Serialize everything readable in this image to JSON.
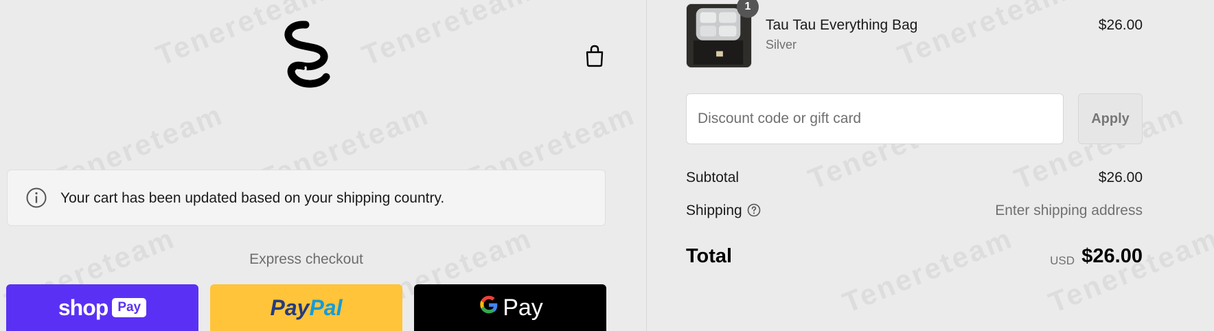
{
  "watermark": {
    "text": "Tenereteam"
  },
  "header": {
    "logo_icon": "tau-tau-logo-icon",
    "cart_icon": "shopping-bag-icon"
  },
  "notice": {
    "icon": "info-icon",
    "message": "Your cart has been updated based on your shipping country."
  },
  "express_checkout": {
    "heading": "Express checkout",
    "shop_pay": {
      "word": "shop",
      "badge": "Pay",
      "color": "#5a31f4"
    },
    "paypal": {
      "part1": "Pay",
      "part2": "Pal",
      "color": "#ffc439"
    },
    "google_pay": {
      "g": "G",
      "pay": "Pay",
      "color": "#000000"
    }
  },
  "order_summary": {
    "item": {
      "quantity": "1",
      "name": "Tau Tau Everything Bag",
      "variant": "Silver",
      "price": "$26.00"
    },
    "discount": {
      "placeholder": "Discount code or gift card",
      "apply_label": "Apply"
    },
    "subtotal_label": "Subtotal",
    "subtotal_value": "$26.00",
    "shipping_label": "Shipping",
    "shipping_icon": "question-circle-icon",
    "shipping_value": "Enter shipping address",
    "total_label": "Total",
    "total_currency": "USD",
    "total_value": "$26.00"
  }
}
